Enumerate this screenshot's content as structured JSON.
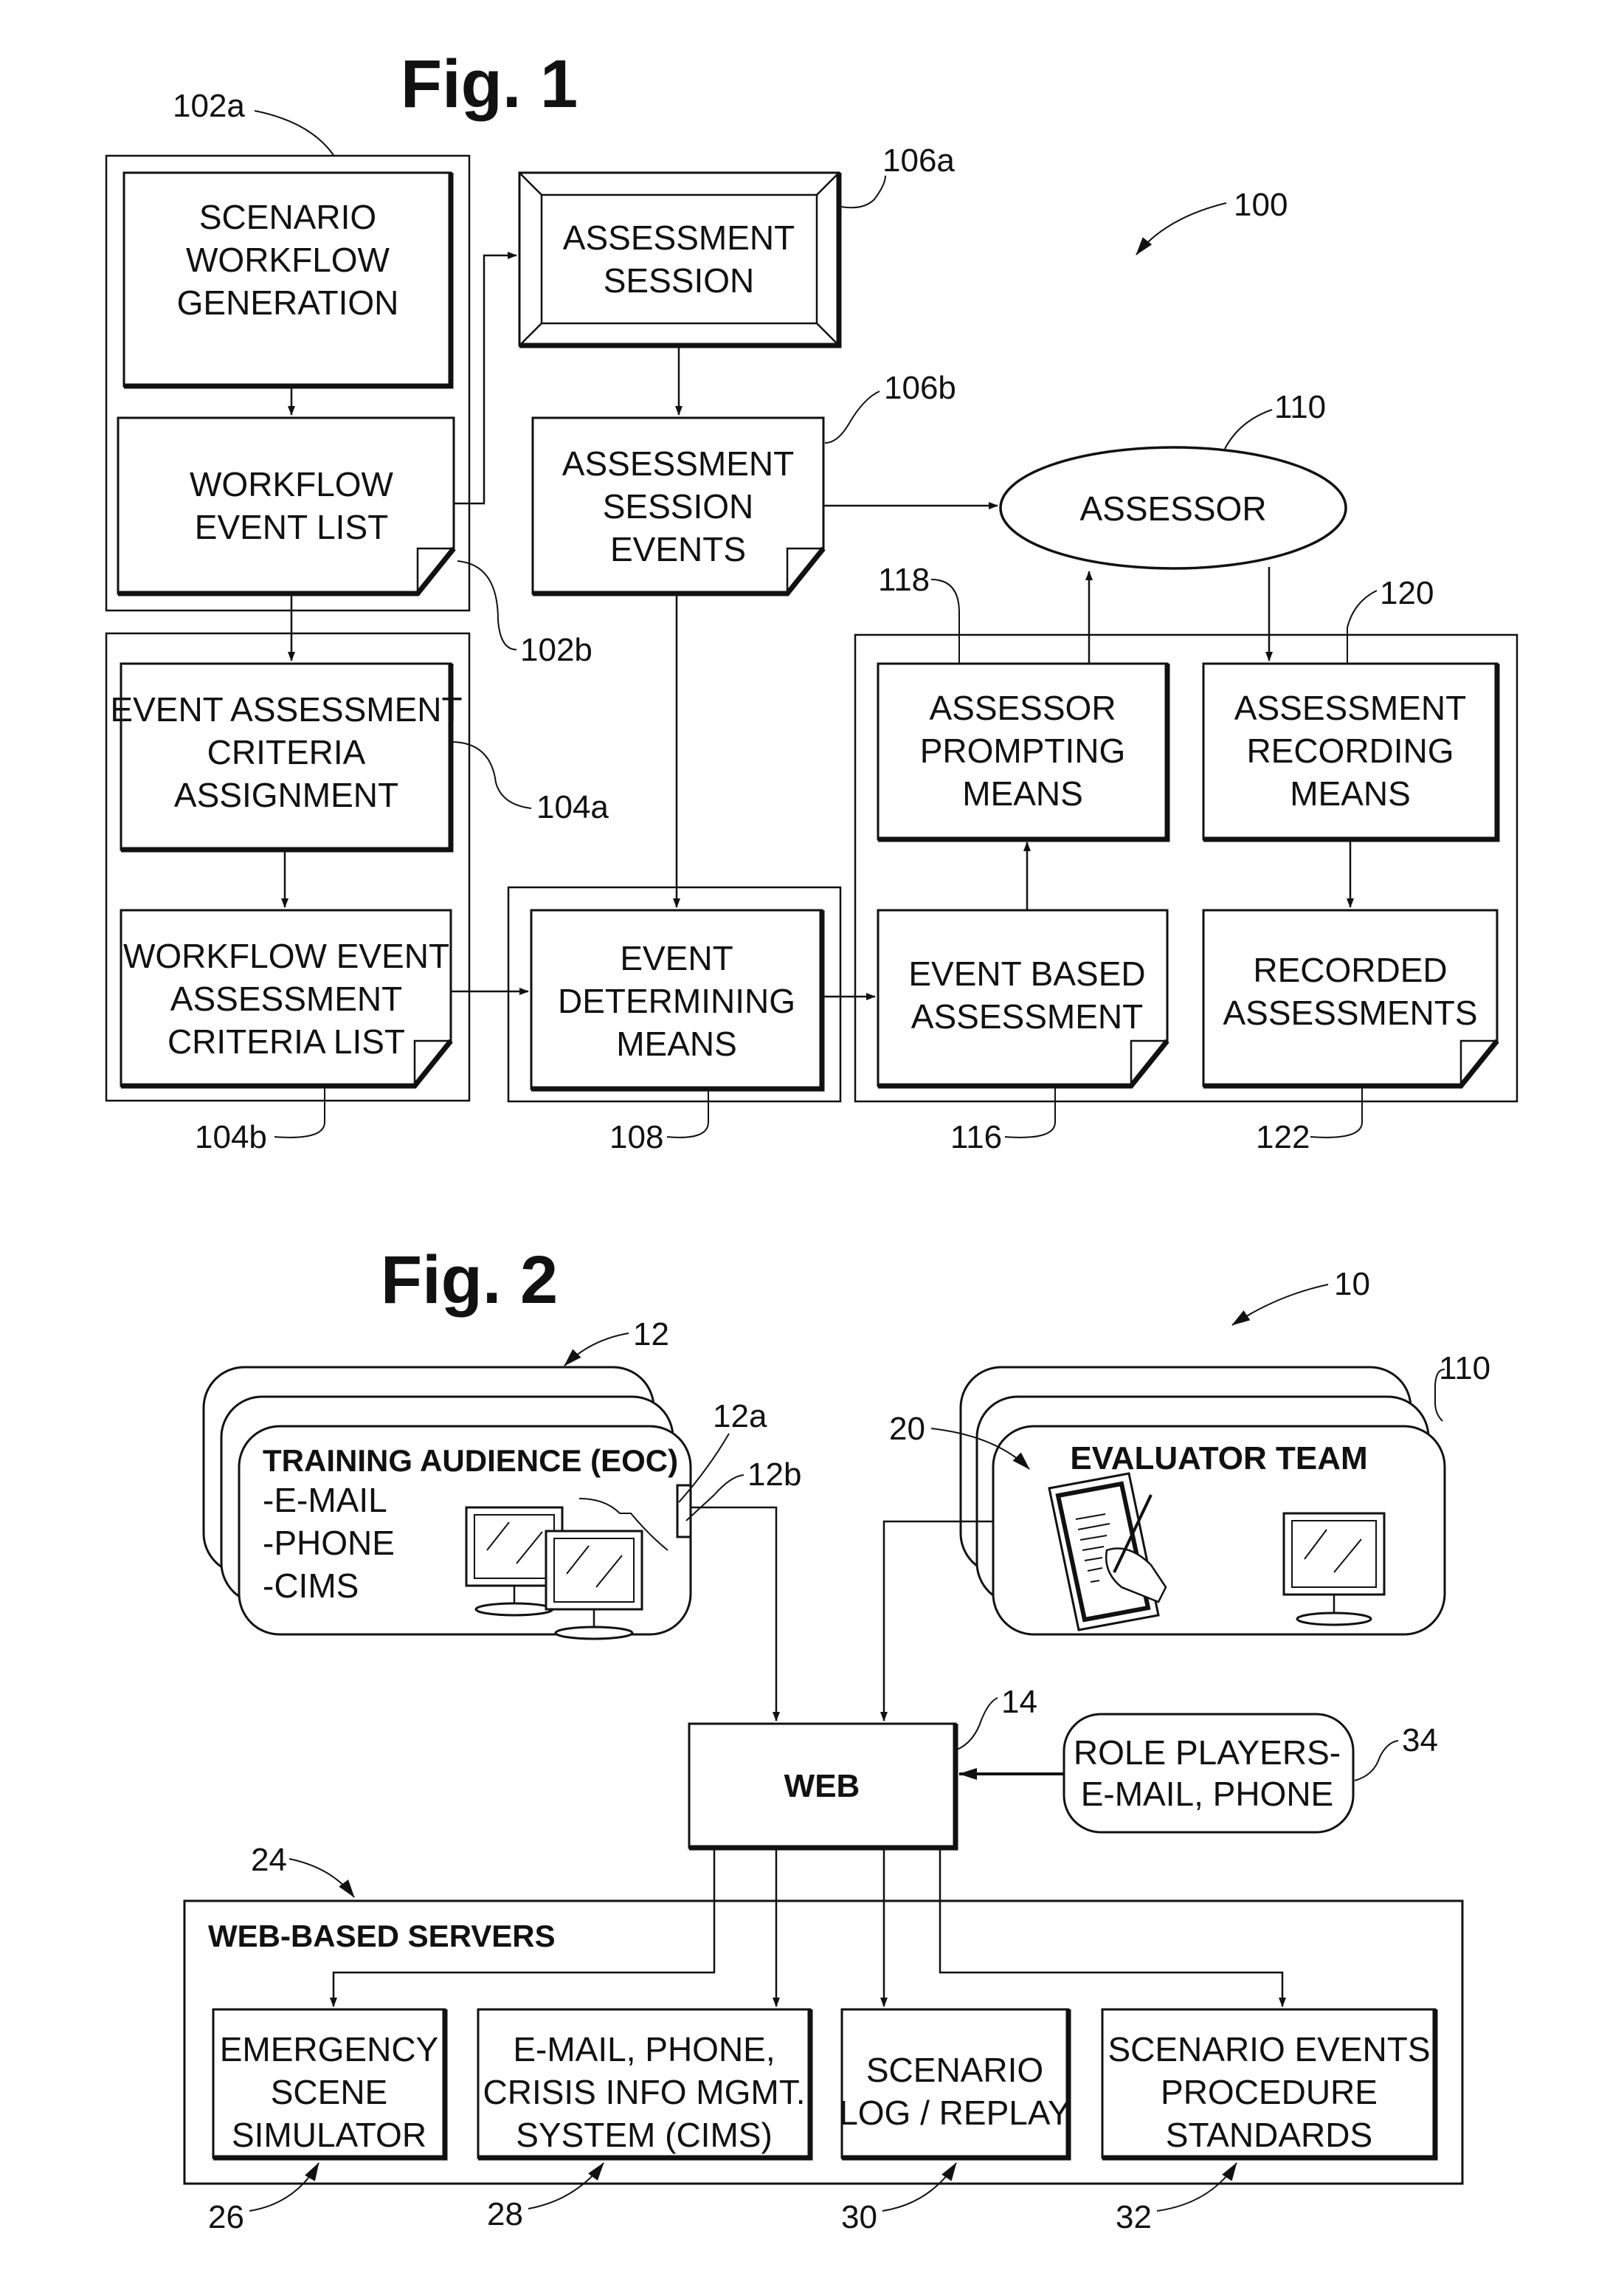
{
  "figures": [
    {
      "title": "Fig. 1",
      "ref": "100",
      "nodes": {
        "scenario_workflow_generation": {
          "ref": "102a",
          "lines": [
            "SCENARIO",
            "WORKFLOW",
            "GENERATION"
          ]
        },
        "workflow_event_list": {
          "ref": "102b",
          "lines": [
            "WORKFLOW",
            "EVENT LIST"
          ]
        },
        "event_assessment_criteria_assignment": {
          "ref": "104a",
          "lines": [
            "EVENT ASSESSMENT",
            "CRITERIA",
            "ASSIGNMENT"
          ]
        },
        "workflow_event_assessment_criteria_list": {
          "ref": "104b",
          "lines": [
            "WORKFLOW EVENT",
            "ASSESSMENT",
            "CRITERIA LIST"
          ]
        },
        "assessment_session": {
          "ref": "106a",
          "lines": [
            "ASSESSMENT",
            "SESSION"
          ]
        },
        "assessment_session_events": {
          "ref": "106b",
          "lines": [
            "ASSESSMENT",
            "SESSION",
            "EVENTS"
          ]
        },
        "event_determining_means": {
          "ref": "108",
          "lines": [
            "EVENT",
            "DETERMINING",
            "MEANS"
          ]
        },
        "assessor": {
          "ref": "110",
          "lines": [
            "ASSESSOR"
          ]
        },
        "event_based_assessment": {
          "ref": "116",
          "lines": [
            "EVENT BASED",
            "ASSESSMENT"
          ]
        },
        "assessor_prompting_means": {
          "ref": "118",
          "lines": [
            "ASSESSOR",
            "PROMPTING",
            "MEANS"
          ]
        },
        "assessment_recording_means": {
          "ref": "120",
          "lines": [
            "ASSESSMENT",
            "RECORDING",
            "MEANS"
          ]
        },
        "recorded_assessments": {
          "ref": "122",
          "lines": [
            "RECORDED",
            "ASSESSMENTS"
          ]
        }
      }
    },
    {
      "title": "Fig. 2",
      "ref": "10",
      "nodes": {
        "training_audience": {
          "ref": "12",
          "sub_refs": [
            "12a",
            "12b"
          ],
          "heading": "TRAINING AUDIENCE (EOC)",
          "items": [
            "-E-MAIL",
            "-PHONE",
            "-CIMS"
          ]
        },
        "evaluator_team": {
          "ref": "110",
          "sub_ref": "20",
          "heading": "EVALUATOR TEAM"
        },
        "web": {
          "ref": "14",
          "lines": [
            "WEB"
          ]
        },
        "role_players": {
          "ref": "34",
          "lines": [
            "ROLE PLAYERS-",
            "E-MAIL, PHONE"
          ]
        },
        "web_based_servers": {
          "ref": "24",
          "heading": "WEB-BASED SERVERS"
        },
        "emergency_scene_simulator": {
          "ref": "26",
          "lines": [
            "EMERGENCY",
            "SCENE",
            "SIMULATOR"
          ]
        },
        "cims": {
          "ref": "28",
          "lines": [
            "E-MAIL, PHONE,",
            "CRISIS INFO MGMT.",
            "SYSTEM (CIMS)"
          ]
        },
        "scenario_log_replay": {
          "ref": "30",
          "lines": [
            "SCENARIO",
            "LOG / REPLAY"
          ]
        },
        "scenario_events_procedure_standards": {
          "ref": "32",
          "lines": [
            "SCENARIO EVENTS",
            "PROCEDURE",
            "STANDARDS"
          ]
        }
      }
    }
  ]
}
